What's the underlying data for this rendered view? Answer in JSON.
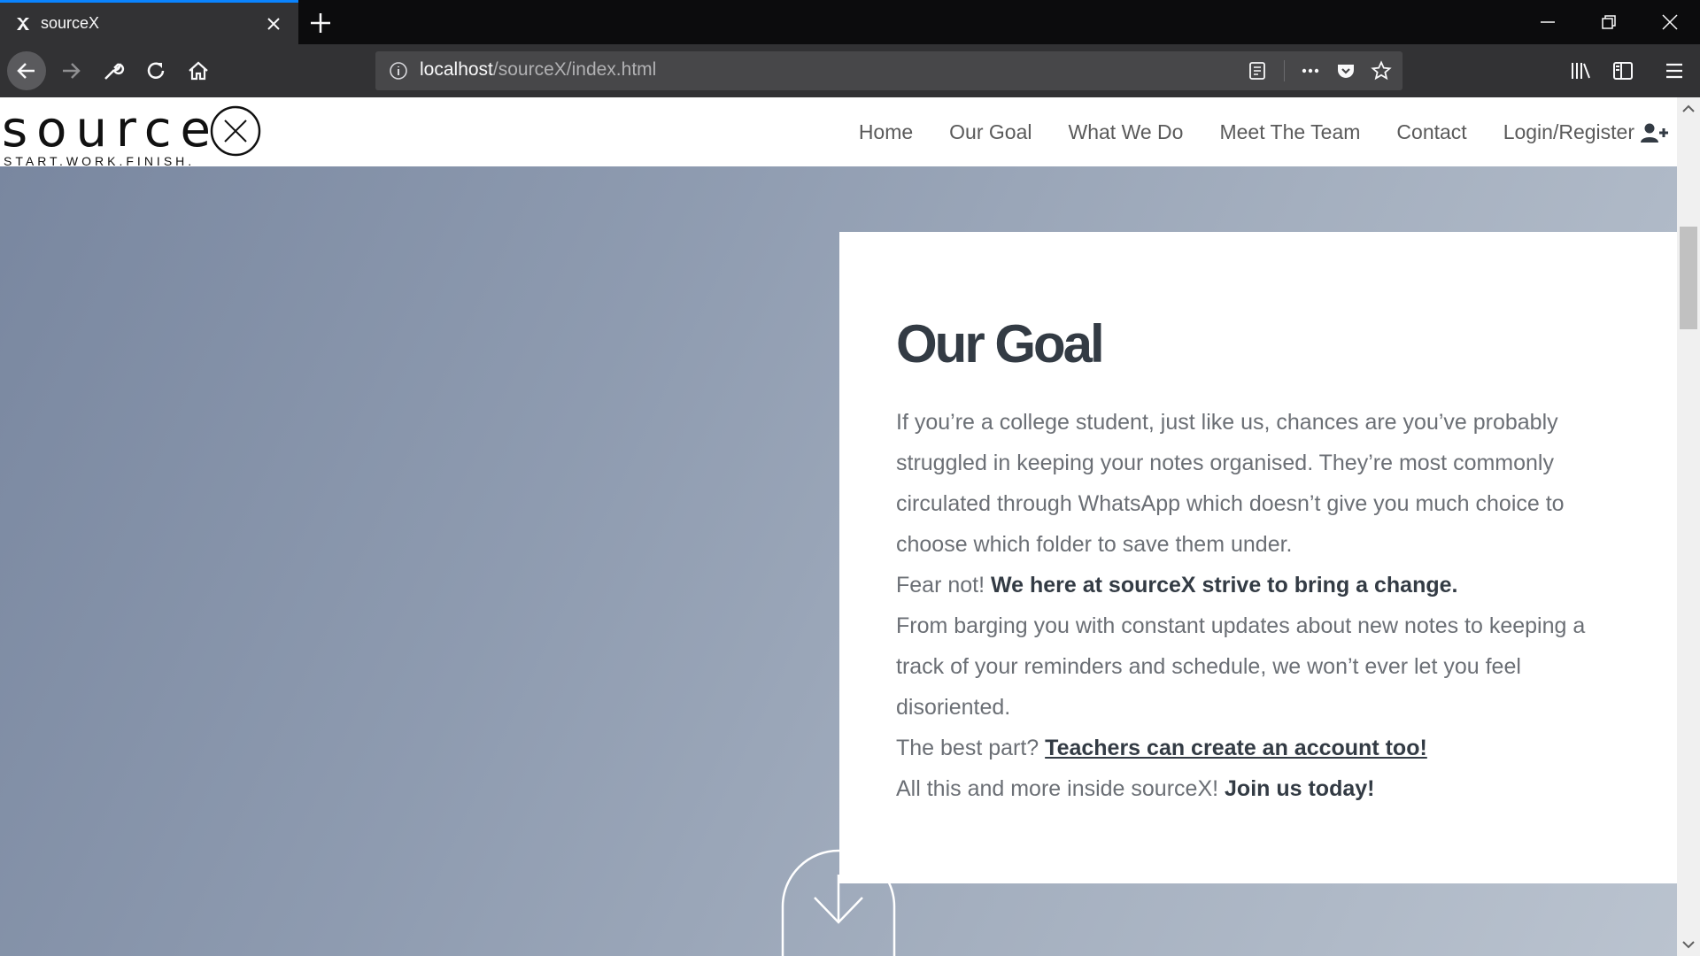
{
  "browser": {
    "tab_title": "sourceX",
    "url_host": "localhost",
    "url_path": "/sourceX/index.html"
  },
  "site": {
    "logo_text": "source",
    "tagline": "START.WORK.FINISH.",
    "nav": {
      "home": "Home",
      "our_goal": "Our Goal",
      "what_we_do": "What We Do",
      "meet_team": "Meet The Team",
      "contact": "Contact",
      "login": "Login/Register"
    }
  },
  "goal": {
    "title": "Our Goal",
    "para1": "If you’re a college student, just like us, chances are you’ve probably struggled in keeping your notes organised. They’re most commonly circulated through WhatsApp which doesn’t give you much choice to choose which folder to save them under.",
    "para2_lead": "Fear not! ",
    "para2_bold": "We here at sourceX strive to bring a change.",
    "para3": "From barging you with constant updates about new notes to keeping a track of your reminders and schedule, we won’t ever let you feel disoriented.",
    "para4_lead": "The best part? ",
    "para4_link": "Teachers can create an account too!",
    "para5_lead": "All this and more inside sourceX! ",
    "para5_bold": "Join us today!"
  }
}
